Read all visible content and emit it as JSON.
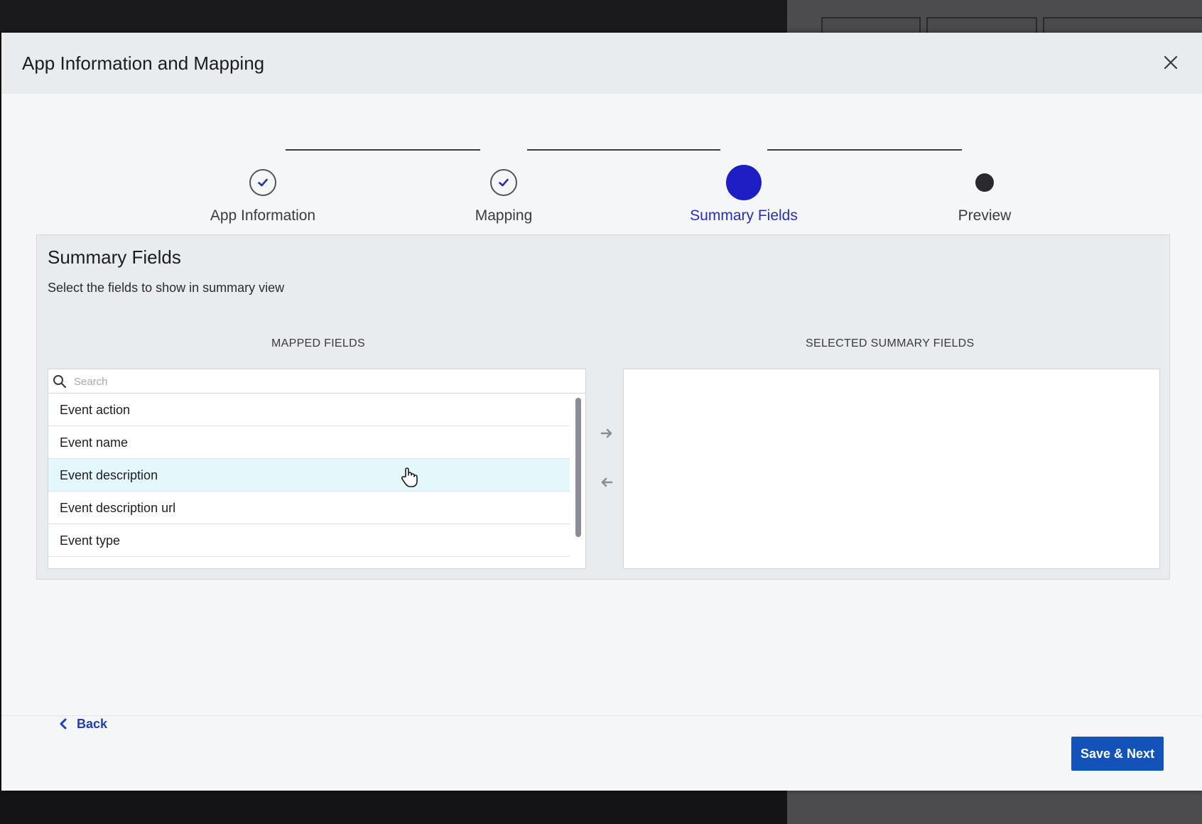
{
  "modal": {
    "title": "App Information and Mapping"
  },
  "stepper": {
    "steps": [
      {
        "label": "App Information",
        "state": "done"
      },
      {
        "label": "Mapping",
        "state": "done"
      },
      {
        "label": "Summary Fields",
        "state": "active"
      },
      {
        "label": "Preview",
        "state": "todo"
      }
    ]
  },
  "panel": {
    "title": "Summary Fields",
    "subtitle": "Select the fields to show in summary view",
    "mapped_header": "MAPPED FIELDS",
    "selected_header": "SELECTED SUMMARY FIELDS",
    "search_placeholder": "Search",
    "mapped_fields": [
      "Event action",
      "Event name",
      "Event description",
      "Event description url",
      "Event type"
    ],
    "hovered_index": 2
  },
  "footer": {
    "back_label": "Back",
    "save_label": "Save & Next"
  },
  "colors": {
    "accent": "#1d1ec4",
    "primary_button": "#1352b8",
    "link": "#1f3fae",
    "hover_row": "#e4f7fb"
  },
  "icons": {
    "close": "close-icon",
    "check": "check-icon",
    "search": "search-icon",
    "move_right": "arrow-right-icon",
    "move_left": "arrow-left-icon",
    "back": "chevron-left-icon"
  }
}
